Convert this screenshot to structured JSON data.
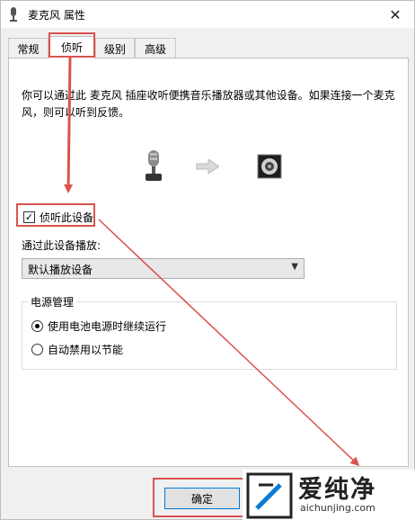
{
  "window": {
    "title": "麦克风 属性",
    "close_glyph": "✕"
  },
  "tabs": [
    {
      "label": "常规"
    },
    {
      "label": "侦听"
    },
    {
      "label": "级别"
    },
    {
      "label": "高级"
    }
  ],
  "active_tab": "侦听",
  "description": "你可以通过此 麦克风 插座收听便携音乐播放器或其他设备。如果连接一个麦克风，则可以听到反馈。",
  "listen_checkbox": {
    "label": "侦听此设备",
    "checked": true,
    "glyph": "✓"
  },
  "playback": {
    "label": "通过此设备播放:",
    "selected": "默认播放设备",
    "arrow_glyph": "▼"
  },
  "power": {
    "title": "电源管理",
    "options": [
      {
        "label": "使用电池电源时继续运行",
        "selected": true
      },
      {
        "label": "自动禁用以节能",
        "selected": false
      }
    ]
  },
  "ok_button": {
    "label": "确定"
  },
  "watermark": {
    "text": "爱纯净",
    "url": "aichunjing.com"
  },
  "colors": {
    "highlight_red": "#d9534f",
    "focus_blue": "#0078d7"
  },
  "icons": [
    "microphone-icon",
    "arrow-right-icon",
    "speaker-icon",
    "close-icon",
    "checkmark-icon",
    "dropdown-arrow-icon"
  ]
}
